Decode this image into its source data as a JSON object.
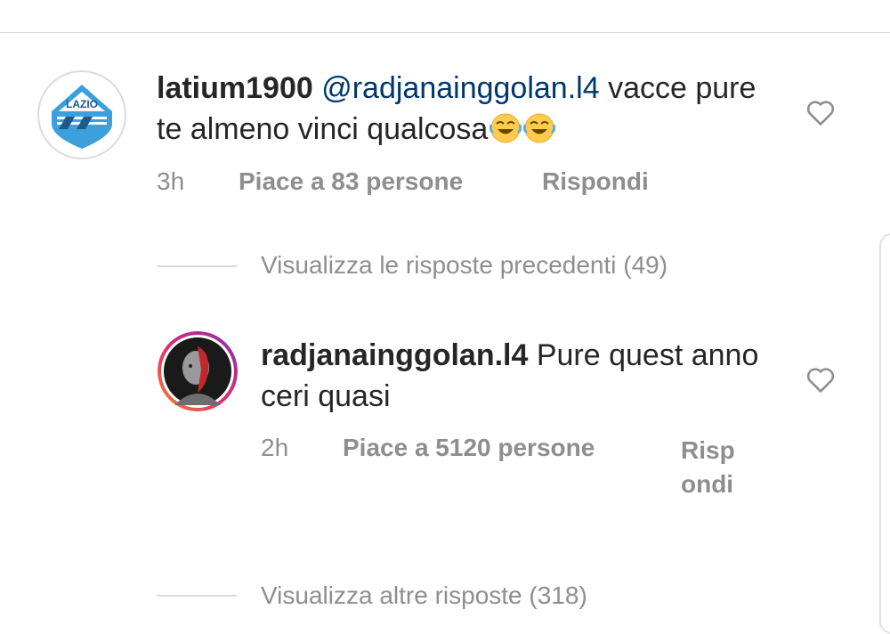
{
  "comments": [
    {
      "username": "latium1900",
      "mention": "@radjanainggolan.l4",
      "text": "vacce pure te almeno vinci qualcosa",
      "emojis": [
        "rolling-laughing-emoji",
        "rolling-laughing-emoji"
      ],
      "avatar_text": "LAZIO",
      "time": "3h",
      "likes": "Piace a 83 persone",
      "reply": "Rispondi"
    },
    {
      "username": "radjanainggolan.l4",
      "text": "Pure quest anno ceri quasi",
      "time": "2h",
      "likes": "Piace a 5120 persone",
      "reply": "Rispondi"
    }
  ],
  "threads": {
    "previous": "Visualizza le risposte precedenti (49)",
    "more": "Visualizza altre risposte (318)"
  },
  "icons": {
    "like": "heart-outline-icon"
  },
  "colors": {
    "text": "#262626",
    "secondary": "#8e8e8e",
    "mention": "#00376b",
    "lazio_blue": "#3ba0dc"
  }
}
